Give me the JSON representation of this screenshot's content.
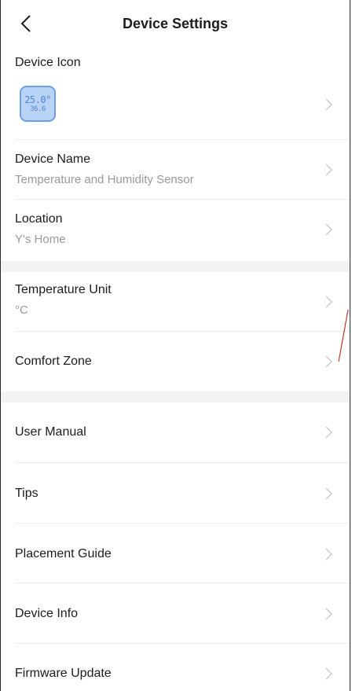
{
  "header": {
    "title": "Device Settings",
    "back_icon": "chevron-left-icon"
  },
  "device_icon": {
    "label": "Device Icon",
    "temp_display": "25.0°",
    "humidity_display": "36.6"
  },
  "device_name": {
    "label": "Device Name",
    "value": "Temperature and Humidity Sensor"
  },
  "location": {
    "label": "Location",
    "value": "Y's Home"
  },
  "temperature_unit": {
    "label": "Temperature Unit",
    "value": "°C"
  },
  "comfort_zone": {
    "label": "Comfort Zone"
  },
  "menu": {
    "user_manual": "User Manual",
    "tips": "Tips",
    "placement_guide": "Placement Guide",
    "device_info": "Device Info",
    "firmware_update": "Firmware Update"
  },
  "colors": {
    "section_gap": "#f3f3f5",
    "divider": "#ececec",
    "secondary_text": "#9a9a9a",
    "icon_fill": "#b9d3f7",
    "icon_stroke": "#6f9fe6",
    "annotation_mark": "#c0392b"
  }
}
